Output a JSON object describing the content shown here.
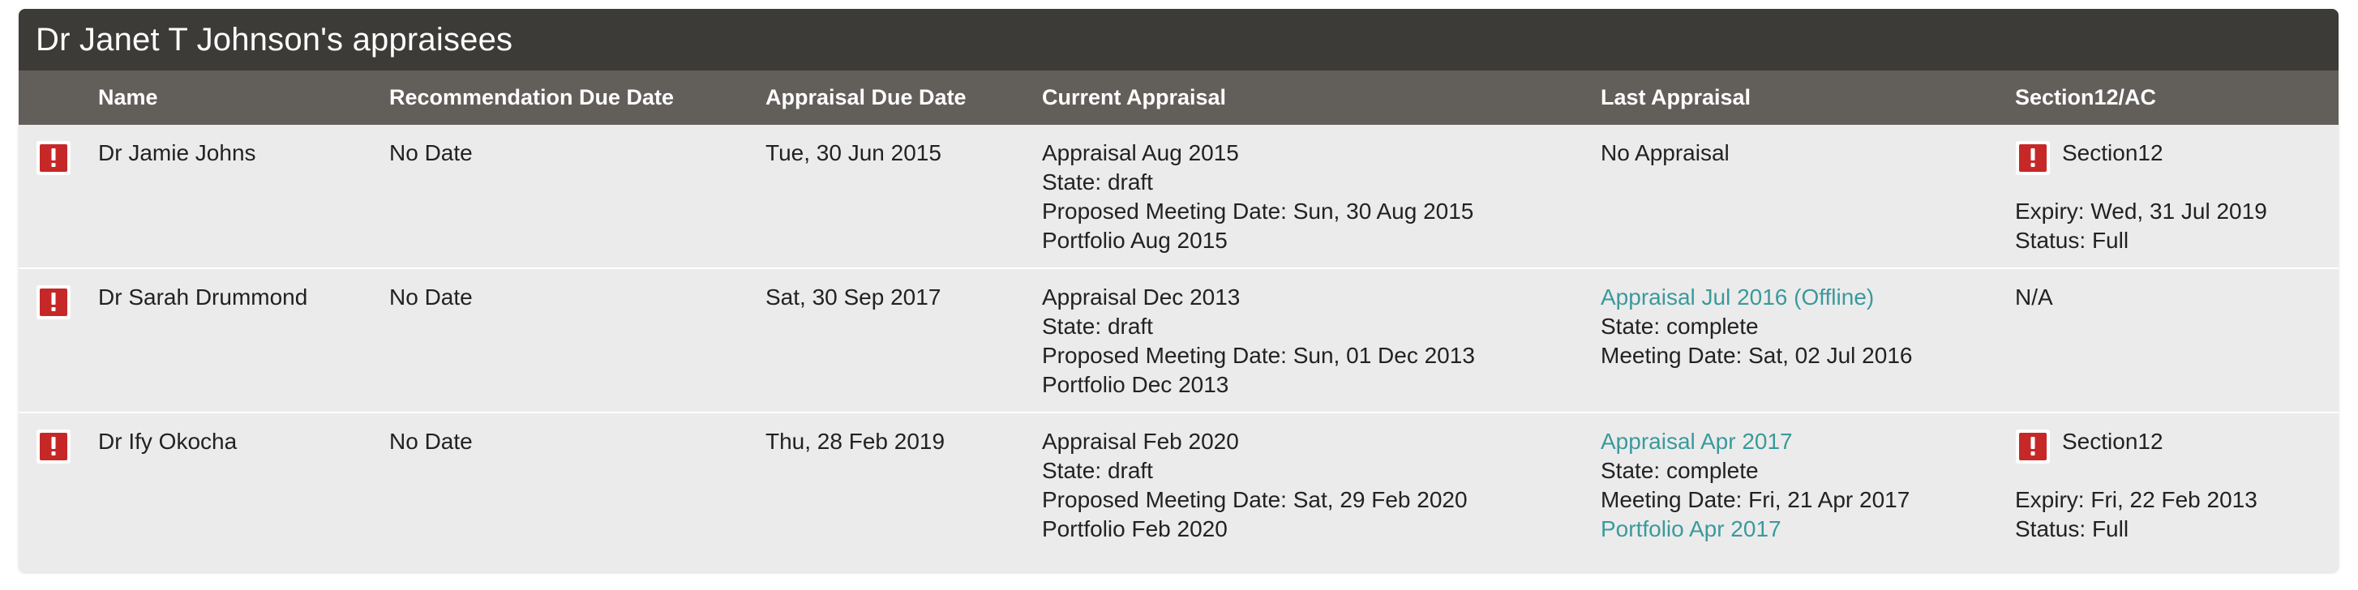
{
  "panel": {
    "title": "Dr Janet T Johnson's appraisees"
  },
  "table": {
    "headers": {
      "name": "Name",
      "recommendation_due": "Recommendation Due Date",
      "appraisal_due": "Appraisal Due Date",
      "current_appraisal": "Current Appraisal",
      "last_appraisal": "Last Appraisal",
      "section12": "Section12/AC"
    },
    "rows": [
      {
        "alert_icon": "exclamation-alert-icon",
        "name": "Dr Jamie Johns",
        "recommendation_due": "No Date",
        "appraisal_due": "Tue, 30 Jun 2015",
        "current": {
          "title": "Appraisal Aug 2015",
          "state": "State: draft",
          "meeting": "Proposed Meeting Date: Sun, 30 Aug 2015",
          "portfolio": "Portfolio Aug 2015"
        },
        "last": {
          "text": "No Appraisal"
        },
        "section12": {
          "label": "Section12",
          "expiry": "Expiry: Wed, 31 Jul 2019",
          "status": "Status: Full"
        }
      },
      {
        "alert_icon": "exclamation-alert-icon",
        "name": "Dr Sarah Drummond",
        "recommendation_due": "No Date",
        "appraisal_due": "Sat, 30 Sep 2017",
        "current": {
          "title": "Appraisal Dec 2013",
          "state": "State: draft",
          "meeting": "Proposed Meeting Date: Sun, 01 Dec 2013",
          "portfolio": "Portfolio Dec 2013"
        },
        "last": {
          "link": "Appraisal Jul 2016 (Offline)",
          "state": "State: complete",
          "meeting": "Meeting Date: Sat, 02 Jul 2016"
        },
        "section12": {
          "text": "N/A"
        }
      },
      {
        "alert_icon": "exclamation-alert-icon",
        "name": "Dr Ify Okocha",
        "recommendation_due": "No Date",
        "appraisal_due": "Thu, 28 Feb 2019",
        "current": {
          "title": "Appraisal Feb 2020",
          "state": "State: draft",
          "meeting": "Proposed Meeting Date: Sat, 29 Feb 2020",
          "portfolio": "Portfolio Feb 2020"
        },
        "last": {
          "link": "Appraisal Apr 2017",
          "state": "State: complete",
          "meeting": "Meeting Date: Fri, 21 Apr 2017",
          "portfolio_link": "Portfolio Apr 2017"
        },
        "section12": {
          "label": "Section12",
          "expiry": "Expiry: Fri, 22 Feb 2013",
          "status": "Status: Full"
        }
      }
    ]
  },
  "colors": {
    "header_bg": "#3c3b38",
    "thead_bg": "#625e5a",
    "body_bg": "#ecebeb",
    "link": "#3a9a9c",
    "alert_red": "#c62828"
  }
}
